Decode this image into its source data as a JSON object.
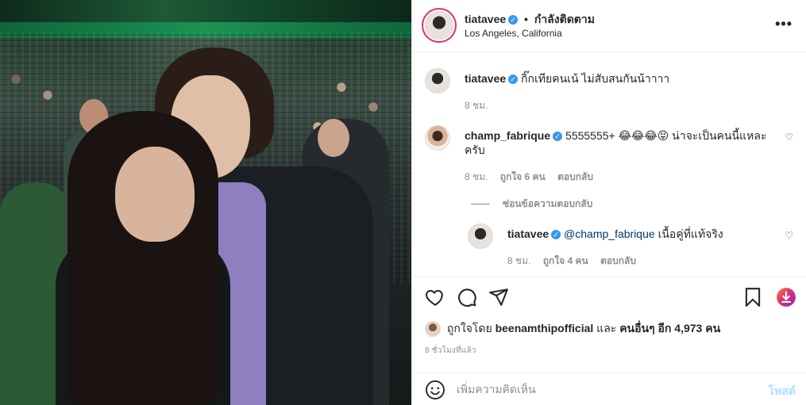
{
  "post": {
    "author": "tiatavee",
    "follow_status": "กำลังติดตาม",
    "separator": "•",
    "location": "Los Angeles, California",
    "more_icon": "more-horizontal-icon"
  },
  "caption": {
    "username": "tiatavee",
    "text": "กิ๊กเทียคนเน้ ไม่สับสนกันน้าาาา",
    "time": "8 ชม."
  },
  "comments": [
    {
      "username": "champ_fabrique",
      "text": "5555555+ 😂😂😂😝 น่าจะเป็นคนนี้แหละครับ",
      "time": "8 ชม.",
      "likes": "ถูกใจ 6 คน",
      "reply": "ตอบกลับ"
    }
  ],
  "hide_replies": "ซ่อนข้อความตอบกลับ",
  "replies": [
    {
      "username": "tiatavee",
      "mention": "@champ_fabrique",
      "text": "เนื้อคู่ที่แท้จริง",
      "time": "8 ชม.",
      "likes": "ถูกใจ 4 คน",
      "reply": "ตอบกลับ"
    }
  ],
  "likes_line": {
    "prefix": "ถูกใจโดย",
    "first_user": "beenamthipofficial",
    "and": "และ",
    "others": "คนอื่นๆ อีก 4,973 คน"
  },
  "timestamp": "8 ชั่วโมงที่แล้ว",
  "add_comment": {
    "placeholder": "เพิ่มความคิดเห็น",
    "post_label": "โพสต์"
  },
  "colors": {
    "verified": "#3897f0",
    "story_ring": "#e1306c",
    "post_disabled": "#b2dffc",
    "meta": "#8e8e8e"
  }
}
